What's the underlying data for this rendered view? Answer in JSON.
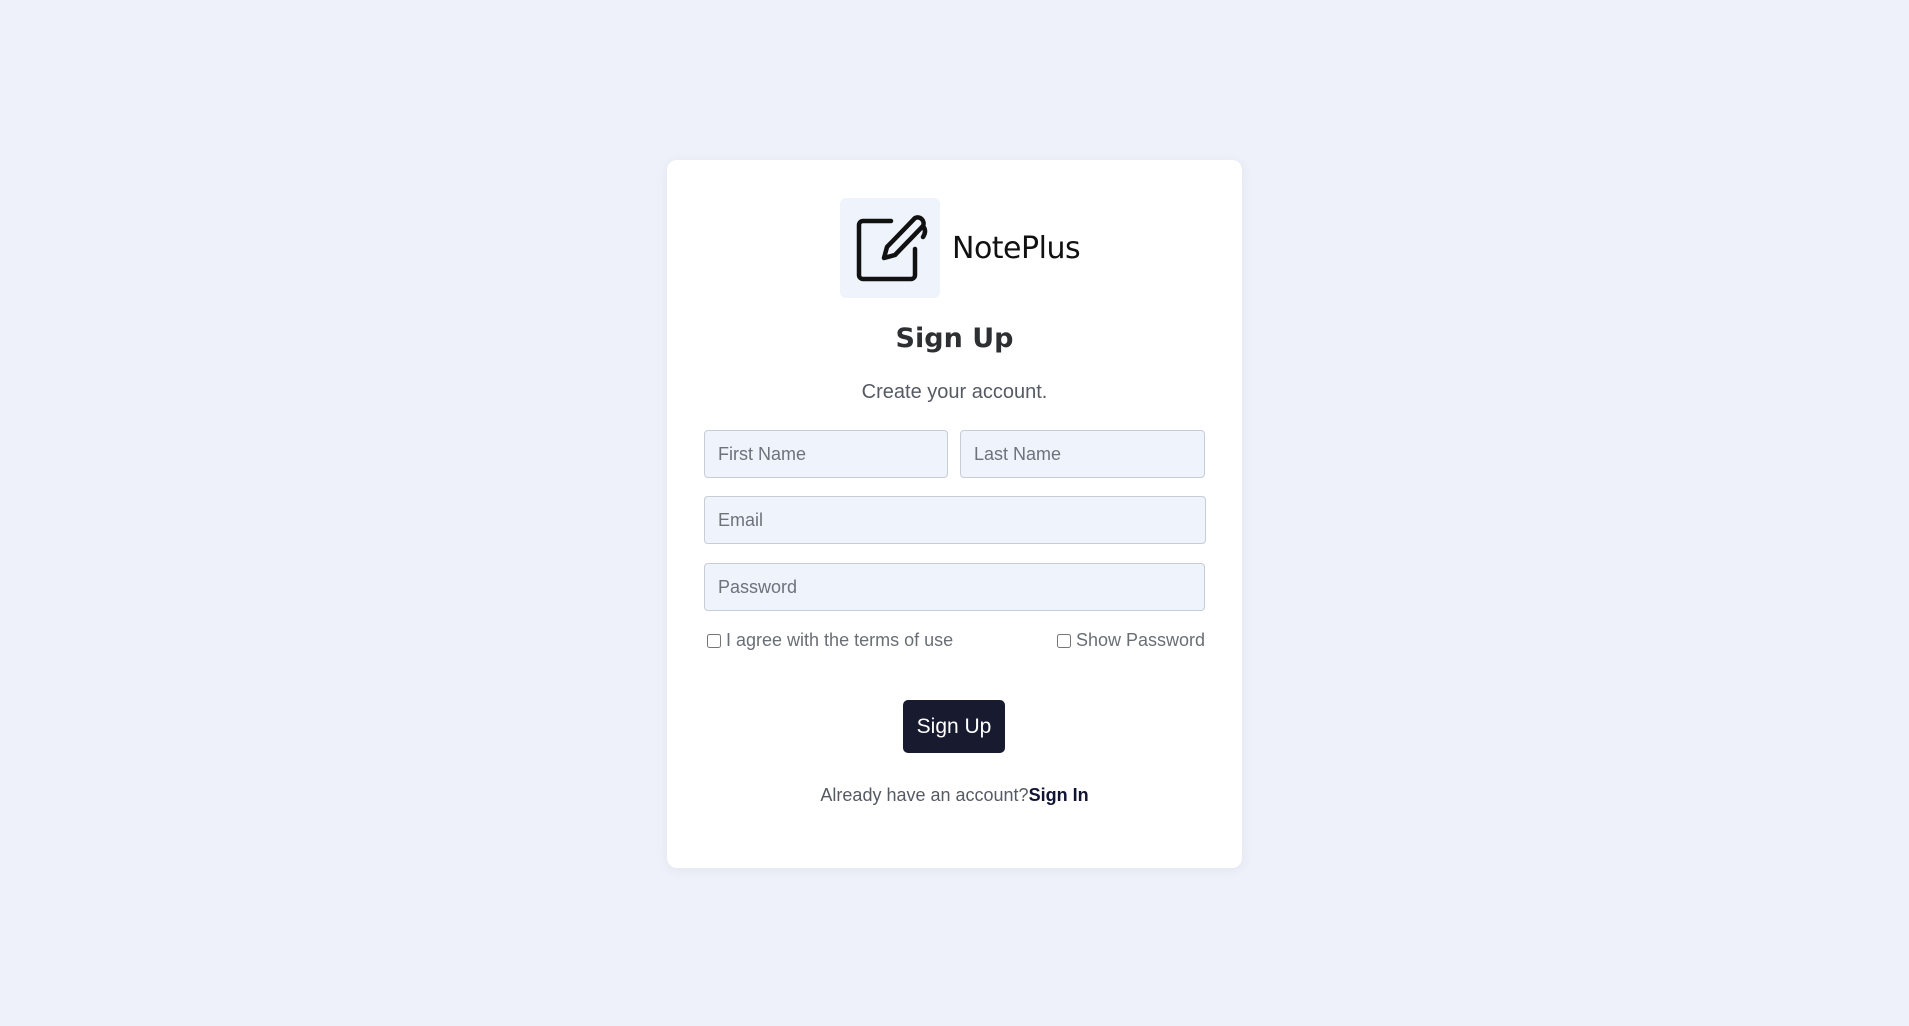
{
  "brand": {
    "name": "NotePlus",
    "logo_icon": "note-edit-icon"
  },
  "form": {
    "title": "Sign Up",
    "subtitle": "Create your account.",
    "first_name_placeholder": "First Name",
    "last_name_placeholder": "Last Name",
    "email_placeholder": "Email",
    "password_placeholder": "Password",
    "terms_label": "I agree with the terms of use",
    "show_password_label": "Show Password",
    "submit_label": "Sign Up"
  },
  "footer": {
    "prompt": "Already have an account?",
    "link_label": "Sign In"
  },
  "colors": {
    "background": "#eef1f9",
    "card": "#ffffff",
    "input_bg": "#eff3fb",
    "button": "#181a2f"
  }
}
